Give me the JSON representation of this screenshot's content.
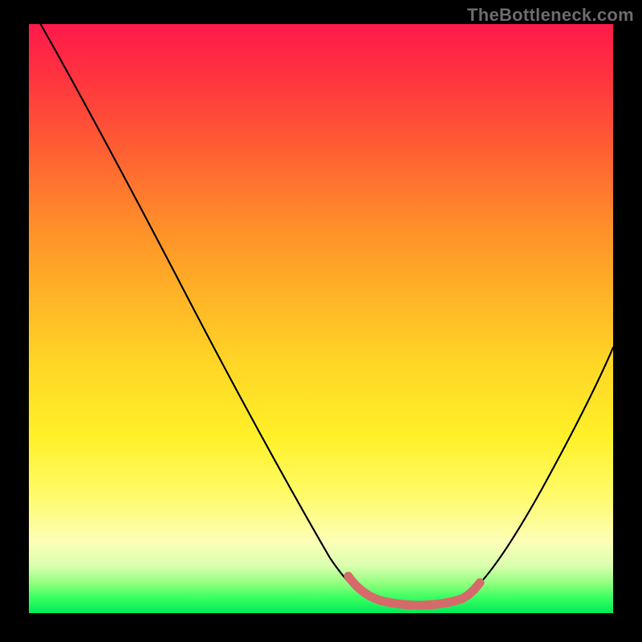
{
  "watermark": "TheBottleneck.com",
  "colors": {
    "gradient_top": "#ff1a4b",
    "gradient_bottom": "#00ea59",
    "curve": "#000000",
    "highlight": "#d66a6a",
    "background": "#000000"
  },
  "chart_data": {
    "type": "line",
    "title": "",
    "xlabel": "",
    "ylabel": "",
    "xlim": [
      0,
      100
    ],
    "ylim": [
      0,
      100
    ],
    "grid": false,
    "legend": false,
    "series": [
      {
        "name": "bottleneck-curve",
        "x": [
          2,
          6,
          10,
          14,
          18,
          22,
          26,
          30,
          34,
          38,
          42,
          46,
          50,
          54,
          58,
          60,
          62,
          66,
          70,
          74,
          78,
          82,
          86,
          90,
          94,
          98,
          100
        ],
        "y": [
          100,
          93,
          86,
          79,
          72,
          65,
          58,
          51,
          44,
          37,
          30,
          23,
          16.5,
          11,
          6,
          4,
          3,
          2.2,
          2.2,
          3.2,
          6,
          10.5,
          16,
          23,
          31,
          40,
          45
        ]
      },
      {
        "name": "optimal-range-highlight",
        "x": [
          58,
          60,
          62,
          66,
          70,
          74,
          76
        ],
        "y": [
          6,
          4,
          3,
          2.2,
          2.2,
          3.2,
          4.5
        ]
      }
    ],
    "annotations": []
  }
}
